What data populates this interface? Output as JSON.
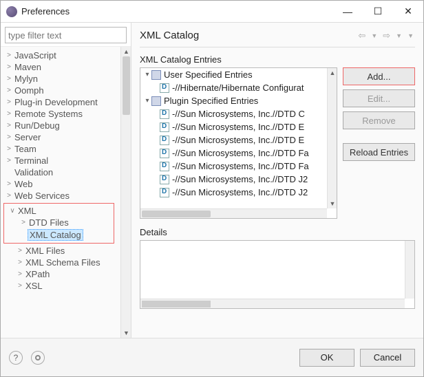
{
  "window": {
    "title": "Preferences"
  },
  "filter": {
    "placeholder": "type filter text"
  },
  "sidebar": {
    "items": [
      {
        "label": "JavaScript",
        "arrow": ">"
      },
      {
        "label": "Maven",
        "arrow": ">"
      },
      {
        "label": "Mylyn",
        "arrow": ">"
      },
      {
        "label": "Oomph",
        "arrow": ">"
      },
      {
        "label": "Plug-in Development",
        "arrow": ">"
      },
      {
        "label": "Remote Systems",
        "arrow": ">"
      },
      {
        "label": "Run/Debug",
        "arrow": ">"
      },
      {
        "label": "Server",
        "arrow": ">"
      },
      {
        "label": "Team",
        "arrow": ">"
      },
      {
        "label": "Terminal",
        "arrow": ">"
      },
      {
        "label": "Validation",
        "arrow": ""
      },
      {
        "label": "Web",
        "arrow": ">"
      },
      {
        "label": "Web Services",
        "arrow": ">"
      }
    ],
    "xml": {
      "label": "XML",
      "arrow": "∨",
      "children": [
        {
          "label": "DTD Files",
          "arrow": ">"
        },
        {
          "label": "XML Catalog",
          "arrow": "",
          "selected": true
        },
        {
          "label": "XML Files",
          "arrow": ">"
        },
        {
          "label": "XML Schema Files",
          "arrow": ">"
        },
        {
          "label": "XPath",
          "arrow": ">"
        },
        {
          "label": "XSL",
          "arrow": ">"
        }
      ]
    }
  },
  "page": {
    "title": "XML Catalog",
    "entries_label": "XML Catalog Entries",
    "details_label": "Details",
    "buttons": {
      "add": "Add...",
      "edit": "Edit...",
      "remove": "Remove",
      "reload": "Reload Entries"
    },
    "catalog": {
      "user_label": "User Specified Entries",
      "user_items": [
        "-//Hibernate/Hibernate Configurat"
      ],
      "plugin_label": "Plugin Specified Entries",
      "plugin_items": [
        "-//Sun Microsystems, Inc.//DTD C",
        "-//Sun Microsystems, Inc.//DTD E",
        "-//Sun Microsystems, Inc.//DTD E",
        "-//Sun Microsystems, Inc.//DTD Fa",
        "-//Sun Microsystems, Inc.//DTD Fa",
        "-//Sun Microsystems, Inc.//DTD J2",
        "-//Sun Microsystems, Inc.//DTD J2"
      ]
    }
  },
  "footer": {
    "ok": "OK",
    "cancel": "Cancel"
  }
}
